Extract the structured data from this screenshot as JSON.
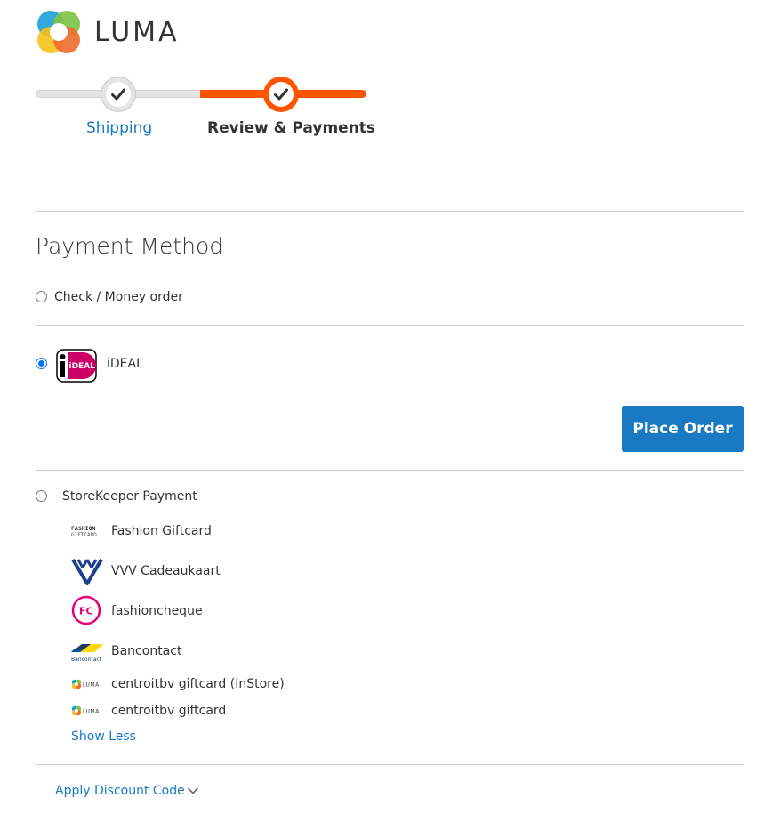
{
  "brand": {
    "name": "LUMA",
    "icon": "luma-logo-icon"
  },
  "progress": {
    "steps": [
      {
        "label": "Shipping",
        "state": "complete",
        "icon": "check-icon"
      },
      {
        "label": "Review & Payments",
        "state": "active",
        "icon": "check-icon"
      }
    ],
    "colors": {
      "active": "#ff5501",
      "inactive": "#e4e4e4",
      "link": "#1979c3"
    }
  },
  "payment": {
    "title": "Payment Method",
    "options": [
      {
        "label": "Check / Money order",
        "selected": false
      },
      {
        "label": "iDEAL",
        "selected": true,
        "logo_text": "iDEAL",
        "icon": "ideal-logo-icon"
      },
      {
        "label": "StoreKeeper Payment",
        "selected": false
      }
    ],
    "place_order_label": "Place Order",
    "storekeeper_methods": [
      {
        "label": "Fashion Giftcard",
        "icon": "fashion-giftcard-icon",
        "logo_lines": [
          "FASHION",
          "GIFTCARD"
        ]
      },
      {
        "label": "VVV Cadeaukaart",
        "icon": "vvv-icon"
      },
      {
        "label": "fashioncheque",
        "icon": "fashioncheque-icon",
        "logo_text": "FC"
      },
      {
        "label": "Bancontact",
        "icon": "bancontact-icon",
        "logo_text": "Bancontact"
      },
      {
        "label": "centroitbv giftcard (InStore)",
        "icon": "luma-small-icon",
        "logo_text": "LUMA"
      },
      {
        "label": "centroitbv giftcard",
        "icon": "luma-small-icon",
        "logo_text": "LUMA"
      }
    ],
    "show_less_label": "Show Less"
  },
  "discount": {
    "label": "Apply Discount Code",
    "icon": "chevron-down-icon"
  }
}
